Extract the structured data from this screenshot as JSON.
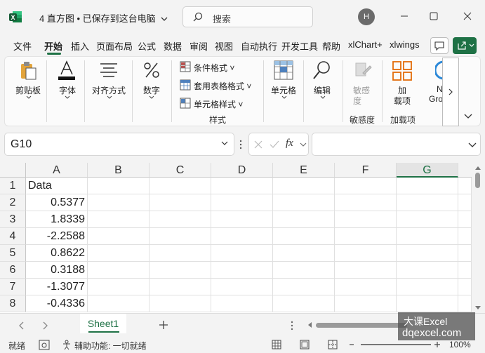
{
  "titlebar": {
    "doc_title": "4 直方图 • 已保存到这台电脑",
    "search_label": "搜索",
    "avatar_initial": "H"
  },
  "tabs": [
    "文件",
    "开始",
    "插入",
    "页面布局",
    "公式",
    "数据",
    "审阅",
    "视图",
    "自动执行",
    "开发工具",
    "帮助",
    "xlChart+",
    "xlwings"
  ],
  "active_tab": "开始",
  "ribbon": {
    "paste": "剪贴板",
    "font": "字体",
    "align": "对齐方式",
    "number": "数字",
    "cond_format": "条件格式",
    "table_format": "套用表格格式",
    "cell_style": "单元格样式",
    "styles_group": "样式",
    "cells": "单元格",
    "edit": "编辑",
    "sensitivity_line1": "敏感",
    "sensitivity_line2": "度",
    "sensitivity_group": "敏感度",
    "addin_line1": "加",
    "addin_line2": "载项",
    "addin_group": "加载项",
    "partial_line1": "N",
    "partial_line2": "Gro"
  },
  "formula_bar": {
    "name_box": "G10",
    "fx": "fx",
    "formula": ""
  },
  "grid": {
    "columns": [
      "A",
      "B",
      "C",
      "D",
      "E",
      "F",
      "G"
    ],
    "selected_column": "G",
    "rows": [
      "1",
      "2",
      "3",
      "4",
      "5",
      "6",
      "7",
      "8"
    ],
    "column_a": [
      "Data",
      "0.5377",
      "1.8339",
      "-2.2588",
      "0.8622",
      "0.3188",
      "-1.3077",
      "-0.4336"
    ]
  },
  "sheets": [
    "Sheet1"
  ],
  "status": {
    "ready": "就绪",
    "accessibility": "辅助功能: 一切就绪",
    "zoom": "100%"
  },
  "watermark": {
    "line1": "大课Excel",
    "line2": "dqexcel.com"
  },
  "colors": {
    "excel_green": "#1e7145",
    "accent_red": "#c0504d",
    "accent_orange": "#e36c09"
  }
}
